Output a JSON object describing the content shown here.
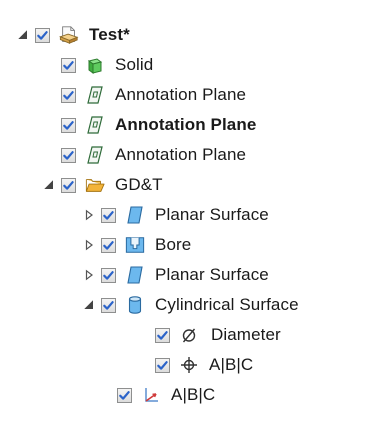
{
  "tree": {
    "root": {
      "label": "Test*"
    },
    "items": [
      {
        "label": "Solid"
      },
      {
        "label": "Annotation Plane"
      },
      {
        "label": "Annotation Plane"
      },
      {
        "label": "Annotation Plane"
      },
      {
        "label": "GD&T"
      },
      {
        "label": "Planar Surface"
      },
      {
        "label": "Bore"
      },
      {
        "label": "Planar Surface"
      },
      {
        "label": "Cylindrical Surface"
      },
      {
        "label": "Diameter"
      },
      {
        "label": "A|B|C"
      },
      {
        "label": "A|B|C"
      }
    ]
  },
  "colors": {
    "check": "#2b63c9",
    "solid": "#48c24b",
    "folder": "#f1b336",
    "surface": "#5aaee8",
    "datum_axis": "#d03a3a"
  }
}
